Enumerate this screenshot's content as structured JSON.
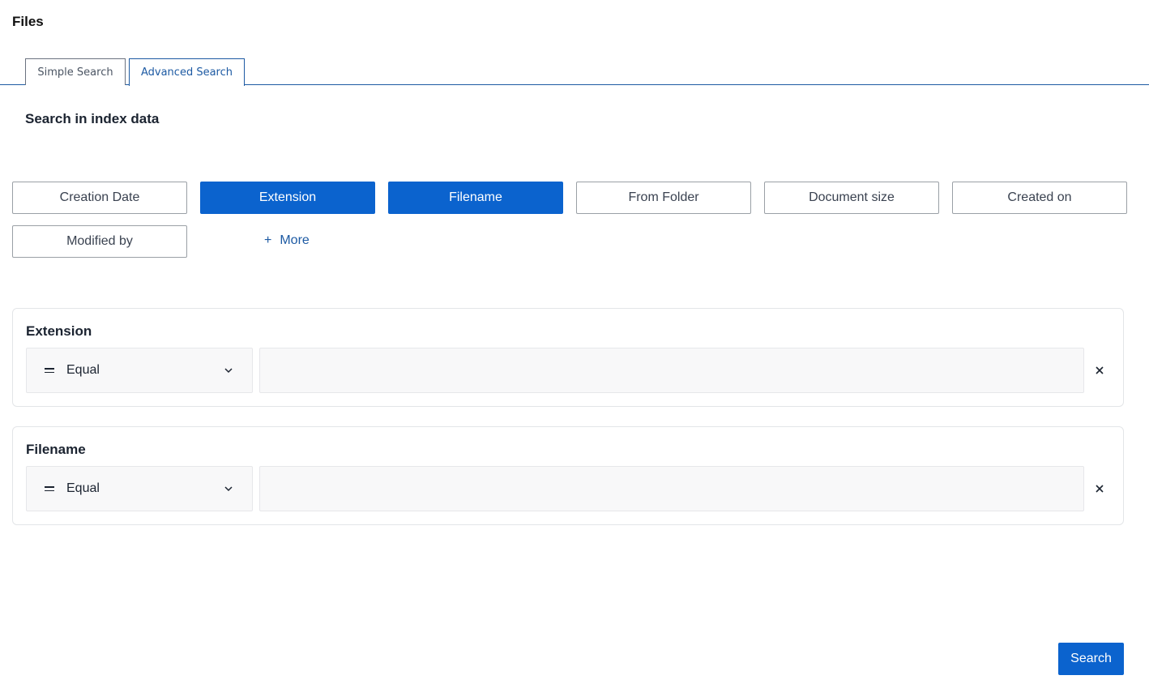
{
  "page": {
    "title": "Files"
  },
  "tabs": [
    {
      "label": "Simple Search",
      "active": false
    },
    {
      "label": "Advanced Search",
      "active": true
    }
  ],
  "section": {
    "title": "Search in index data"
  },
  "fields": [
    {
      "label": "Creation Date",
      "active": false
    },
    {
      "label": "Extension",
      "active": true
    },
    {
      "label": "Filename",
      "active": true
    },
    {
      "label": "From Folder",
      "active": false
    },
    {
      "label": "Document size",
      "active": false
    },
    {
      "label": "Created on",
      "active": false
    },
    {
      "label": "Modified by",
      "active": false
    }
  ],
  "more": {
    "label": "More",
    "icon": "plus-icon"
  },
  "filters": [
    {
      "title": "Extension",
      "operator": "Equal",
      "value": ""
    },
    {
      "title": "Filename",
      "operator": "Equal",
      "value": ""
    }
  ],
  "actions": {
    "search_label": "Search"
  },
  "colors": {
    "primary": "#0b63ce",
    "tab_accent": "#1d5aa3",
    "input_bg": "#f8f8f9"
  }
}
